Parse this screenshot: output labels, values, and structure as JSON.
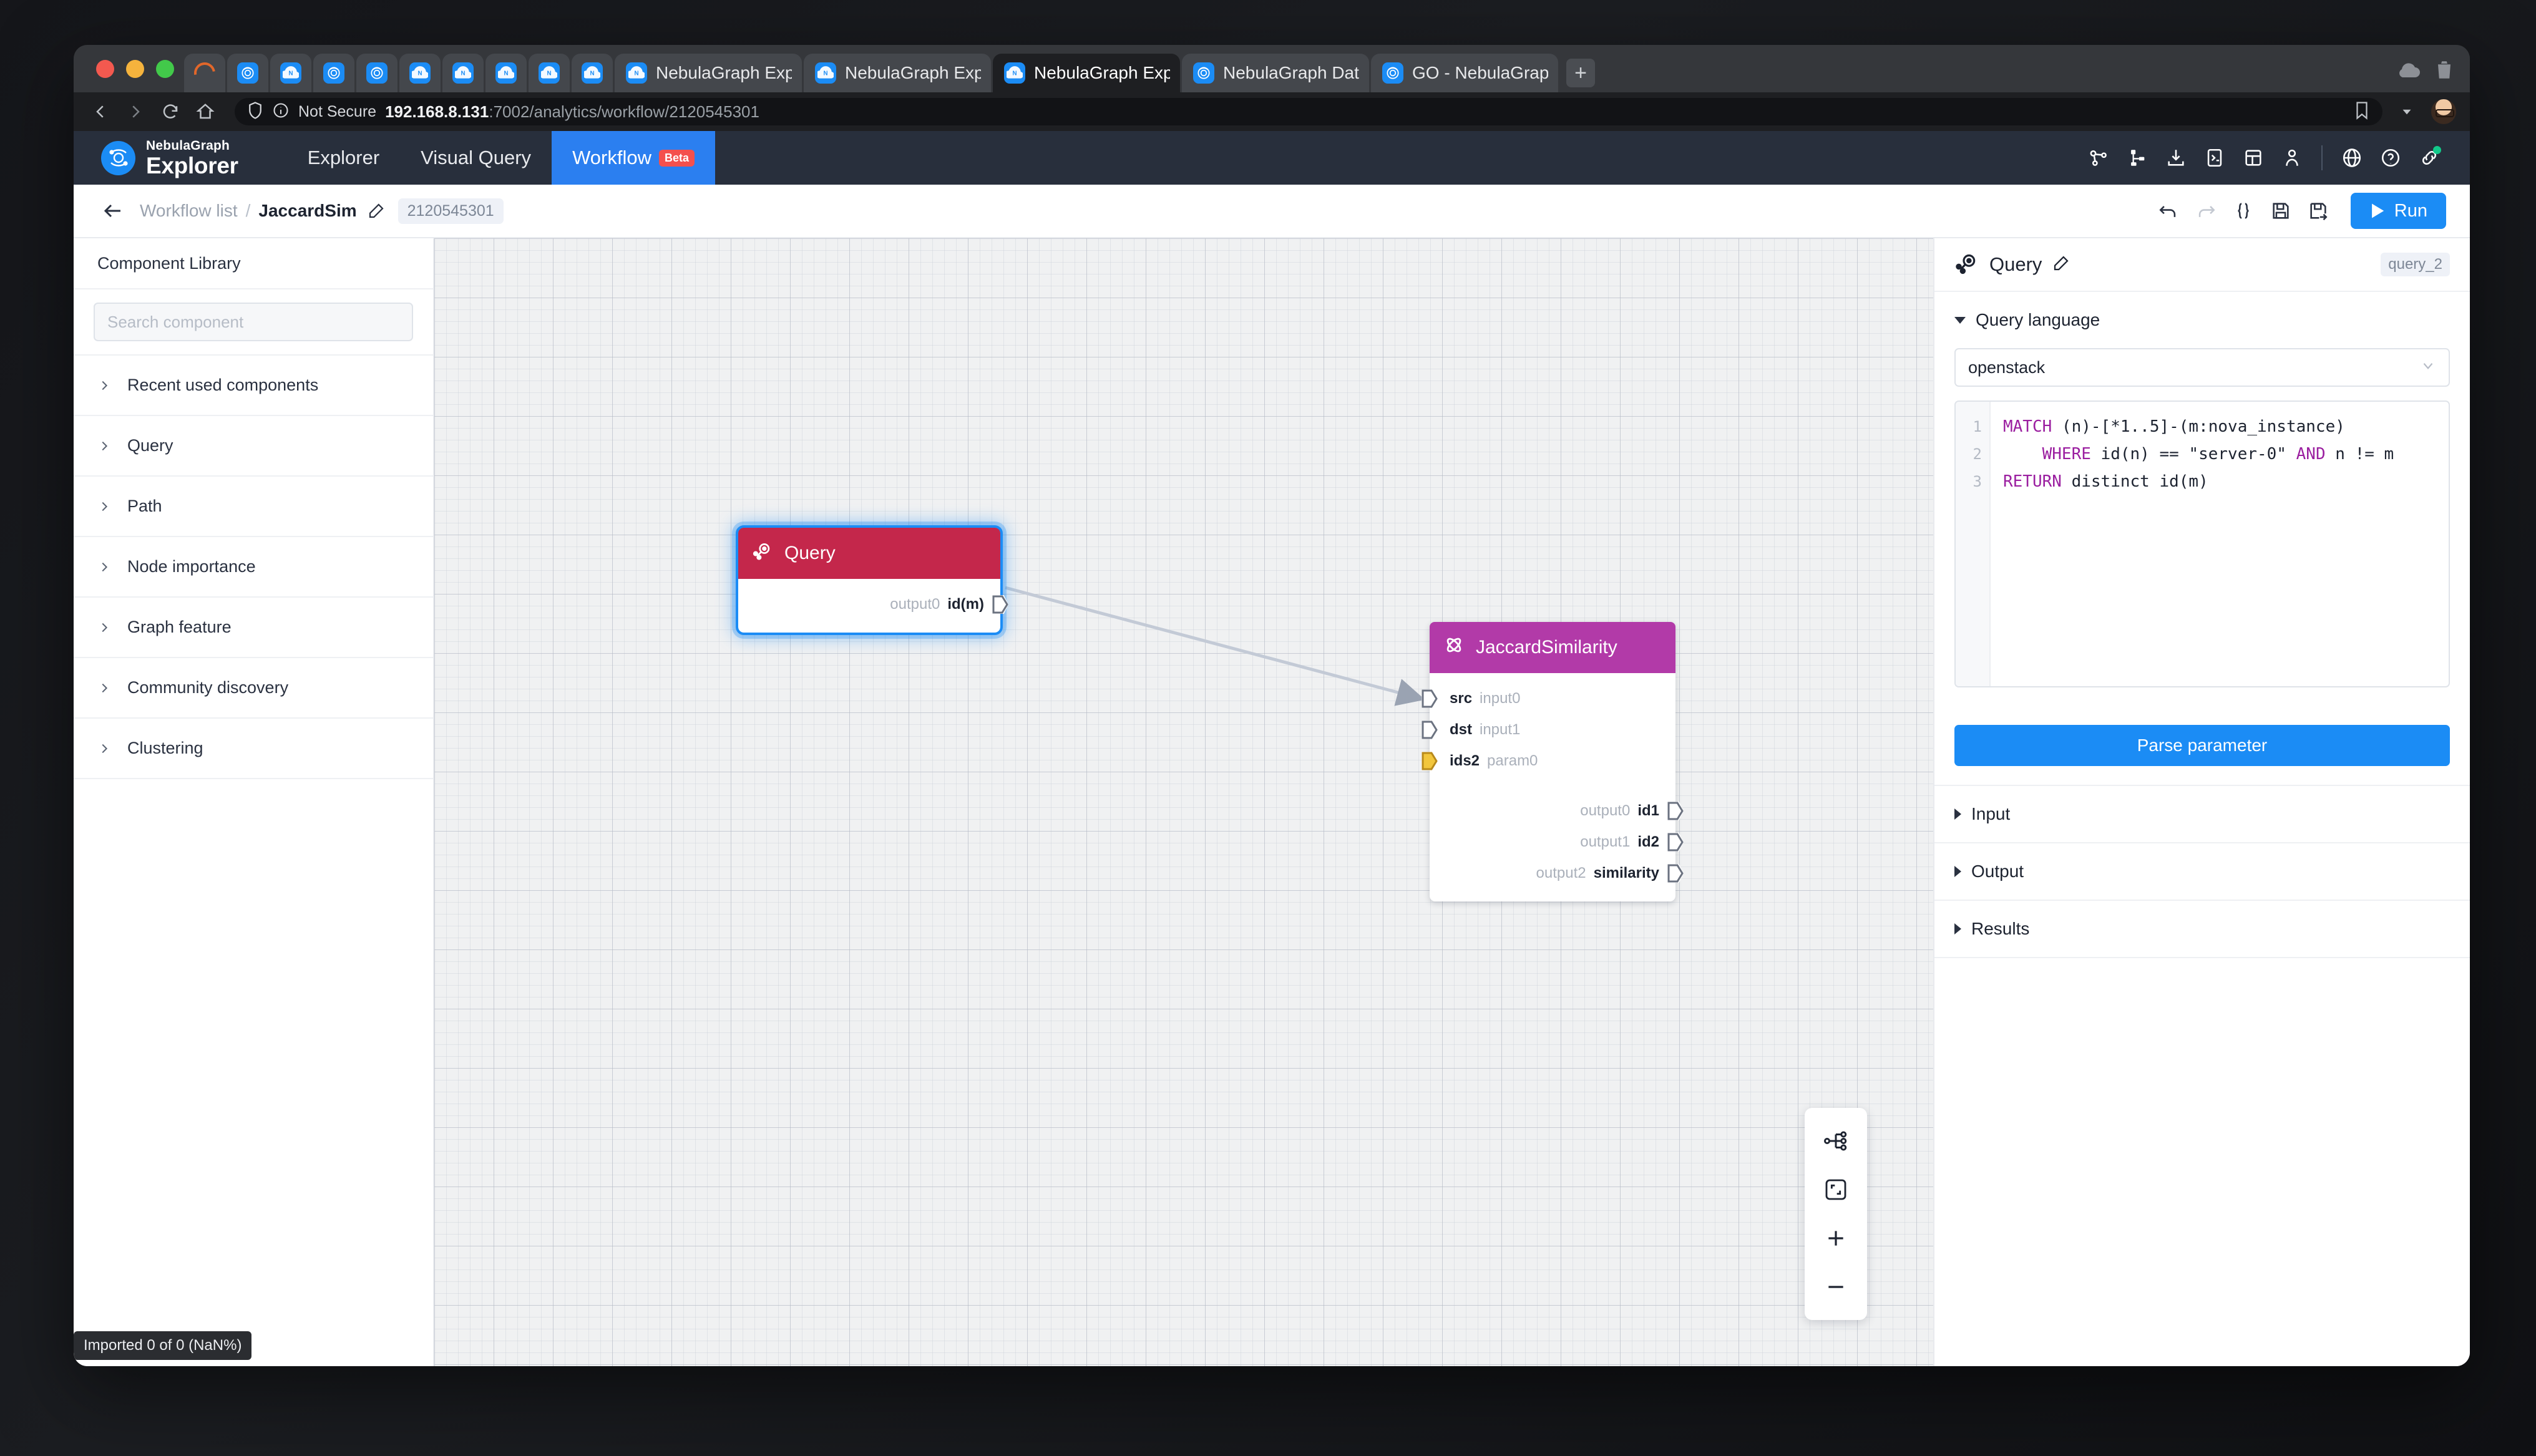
{
  "browser": {
    "tabs": [
      {
        "title": "",
        "icon": "loading-spinner",
        "narrow": true,
        "active": false
      },
      {
        "title": "",
        "icon": "nebula-circle-icon",
        "narrow": true,
        "active": false
      },
      {
        "title": "",
        "icon": "nebula-cloud-icon",
        "narrow": true,
        "active": false
      },
      {
        "title": "",
        "icon": "nebula-circle-icon",
        "narrow": true,
        "active": false
      },
      {
        "title": "",
        "icon": "nebula-circle-icon",
        "narrow": true,
        "active": false
      },
      {
        "title": "",
        "icon": "nebula-cloud-icon",
        "narrow": true,
        "active": false
      },
      {
        "title": "",
        "icon": "nebula-cloud-icon",
        "narrow": true,
        "active": false
      },
      {
        "title": "",
        "icon": "nebula-cloud-icon",
        "narrow": true,
        "active": false
      },
      {
        "title": "",
        "icon": "nebula-cloud-icon",
        "narrow": true,
        "active": false
      },
      {
        "title": "",
        "icon": "nebula-cloud-icon",
        "narrow": true,
        "active": false
      },
      {
        "title": "NebulaGraph Explorer",
        "icon": "nebula-cloud-icon",
        "narrow": false,
        "active": false
      },
      {
        "title": "NebulaGraph Explorer",
        "icon": "nebula-cloud-icon",
        "narrow": false,
        "active": false
      },
      {
        "title": "NebulaGraph Explorer",
        "icon": "nebula-cloud-icon",
        "narrow": false,
        "active": true
      },
      {
        "title": "NebulaGraph Database Ma",
        "icon": "nebula-circle-icon",
        "narrow": false,
        "active": false
      },
      {
        "title": "GO - NebulaGraph Databa",
        "icon": "nebula-circle-icon",
        "narrow": false,
        "active": false
      }
    ],
    "new_tab_label": "+",
    "security_label": "Not Secure",
    "url_host": "192.168.8.131",
    "url_path": ":7002/analytics/workflow/2120545301"
  },
  "app_header": {
    "logo_top": "NebulaGraph",
    "logo_bottom": "Explorer",
    "nav": [
      {
        "label": "Explorer",
        "active": false,
        "badge": ""
      },
      {
        "label": "Visual Query",
        "active": false,
        "badge": ""
      },
      {
        "label": "Workflow",
        "active": true,
        "badge": "Beta"
      }
    ],
    "right_icons": [
      "graph-schema-icon",
      "tree-icon",
      "import-icon",
      "console-icon",
      "dashboard-icon",
      "user-icon",
      "globe-icon",
      "help-icon",
      "connection-icon"
    ]
  },
  "subbar": {
    "back_icon": "back-arrow-icon",
    "crumb_root": "Workflow list",
    "crumb_sep": "/",
    "crumb_current": "JaccardSim",
    "edit_icon": "edit-pencil-icon",
    "workflow_id": "2120545301",
    "actions": [
      "undo-icon",
      "redo-icon",
      "braces-icon",
      "save-icon",
      "save-as-icon"
    ],
    "run_label": "Run"
  },
  "sidebar": {
    "title": "Component Library",
    "search_placeholder": "Search component",
    "search_value": "",
    "items": [
      {
        "label": "Recent used components"
      },
      {
        "label": "Query"
      },
      {
        "label": "Path"
      },
      {
        "label": "Node importance"
      },
      {
        "label": "Graph feature"
      },
      {
        "label": "Community discovery"
      },
      {
        "label": "Clustering"
      }
    ]
  },
  "canvas": {
    "nodes": [
      {
        "id": "query",
        "title": "Query",
        "icon": "query-magnifier-icon",
        "header_color": "#c4274b",
        "selected": true,
        "inputs": [],
        "outputs": [
          {
            "idx": "output0",
            "name": "id(m)"
          }
        ]
      },
      {
        "id": "jaccard",
        "title": "JaccardSimilarity",
        "icon": "jaccard-atom-icon",
        "header_color": "#b23aa8",
        "selected": false,
        "inputs": [
          {
            "name": "src",
            "idx": "input0",
            "highlight": false
          },
          {
            "name": "dst",
            "idx": "input1",
            "highlight": false
          },
          {
            "name": "ids2",
            "idx": "param0",
            "highlight": true
          }
        ],
        "outputs": [
          {
            "idx": "output0",
            "name": "id1"
          },
          {
            "idx": "output1",
            "name": "id2"
          },
          {
            "idx": "output2",
            "name": "similarity"
          }
        ]
      }
    ],
    "tools": [
      "auto-layout-icon",
      "fit-view-icon",
      "zoom-in-icon",
      "zoom-out-icon"
    ],
    "status_text": "Imported 0 of 0 (NaN%)"
  },
  "right_panel": {
    "icon": "query-magnifier-icon",
    "title": "Query",
    "edit_icon": "edit-pencil-icon",
    "chip": "query_2",
    "query_language": {
      "section_label": "Query language",
      "selected": "openstack",
      "code_lines": [
        {
          "num": "1",
          "tokens": [
            {
              "t": "MATCH",
              "kw": true
            },
            {
              "t": " (n)-[*1..5]-(m:nova_instance)",
              "kw": false
            }
          ]
        },
        {
          "num": "2",
          "tokens": [
            {
              "t": "    ",
              "kw": false
            },
            {
              "t": "WHERE",
              "kw": true
            },
            {
              "t": " id(n) == \"server-0\" ",
              "kw": false
            },
            {
              "t": "AND",
              "kw": true
            },
            {
              "t": " n != m",
              "kw": false
            }
          ]
        },
        {
          "num": "3",
          "tokens": [
            {
              "t": "RETURN",
              "kw": true
            },
            {
              "t": " distinct id(m)",
              "kw": false
            }
          ]
        }
      ]
    },
    "parse_button": "Parse parameter",
    "sections": [
      {
        "label": "Input"
      },
      {
        "label": "Output"
      },
      {
        "label": "Results"
      }
    ]
  },
  "colors": {
    "accent": "#1b8cf5",
    "header_bg": "#282f3c",
    "query_node": "#c4274b",
    "jaccard_node": "#b23aa8",
    "beta_badge": "#f4504d",
    "keyword": "#9b1fa0"
  }
}
